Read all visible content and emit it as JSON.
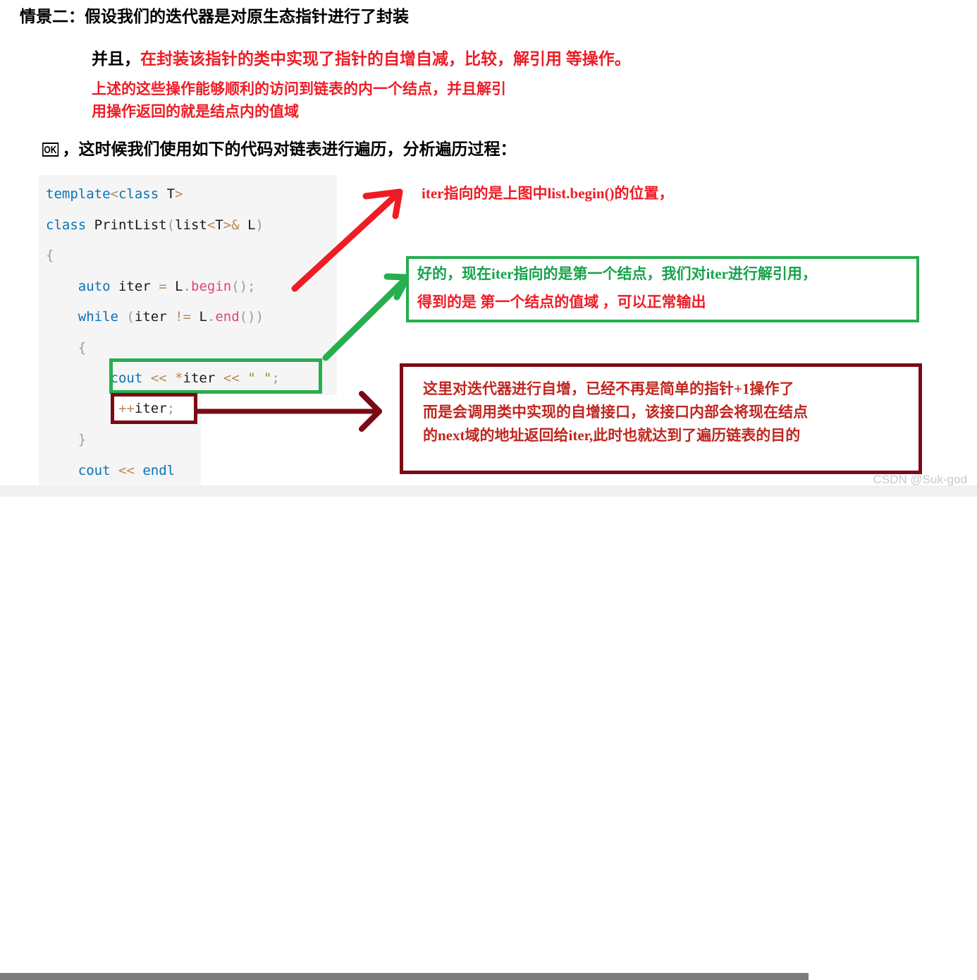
{
  "document": {
    "title_line": "情景二：假设我们的迭代器是对原生态指针进行了封装",
    "line2_black": "并且，",
    "line2_red": "在封装该指针的类中实现了指针的自增自减，比较，解引用 等操作。",
    "line3_red": "上述的这些操作能够顺利的访问到链表的内一个结点，并且解引",
    "line4_red": "用操作返回的就是结点内的值域",
    "line5_badge": "OK",
    "line5_text": "，这时候我们使用如下的代码对链表进行遍历，分析遍历过程："
  },
  "code": {
    "language": "cpp",
    "lines": [
      "template<class T>",
      "class PrintList(list<T>& L)",
      "{",
      "    auto iter = L.begin();",
      "    while (iter != L.end())",
      "    {",
      "        cout << *iter << \" \";",
      "        ++iter;",
      "    }",
      "    cout << endl"
    ],
    "highlight_green_line": "cout << *iter << \" \";",
    "highlight_darkred_line": "++iter;"
  },
  "annotations": {
    "red_note": "iter指向的是上图中list.begin()的位置，",
    "green_box": {
      "line1": "好的，现在iter指向的是第一个结点，我们对iter进行解引用，",
      "line2": "得到的是 第一个结点的值域 ，可以正常输出"
    },
    "darkred_box": {
      "line1": "这里对迭代器进行自增，已经不再是简单的指针+1操作了",
      "line2": "而是会调用类中实现的自增接口，该接口内部会将现在结点",
      "line3": "的next域的地址返回给iter,此时也就达到了遍历链表的目的"
    }
  },
  "watermark": "CSDN @Suk-god",
  "colors": {
    "red": "#ee1c25",
    "green": "#27ae4f",
    "dark_red": "#7b0a14",
    "code_bg": "#f5f5f5",
    "keyword_blue": "#0b72b5",
    "function_pink": "#e0457b",
    "operator_tan": "#b58b5a",
    "scrollbar_thumb": "#7c7c7c"
  }
}
